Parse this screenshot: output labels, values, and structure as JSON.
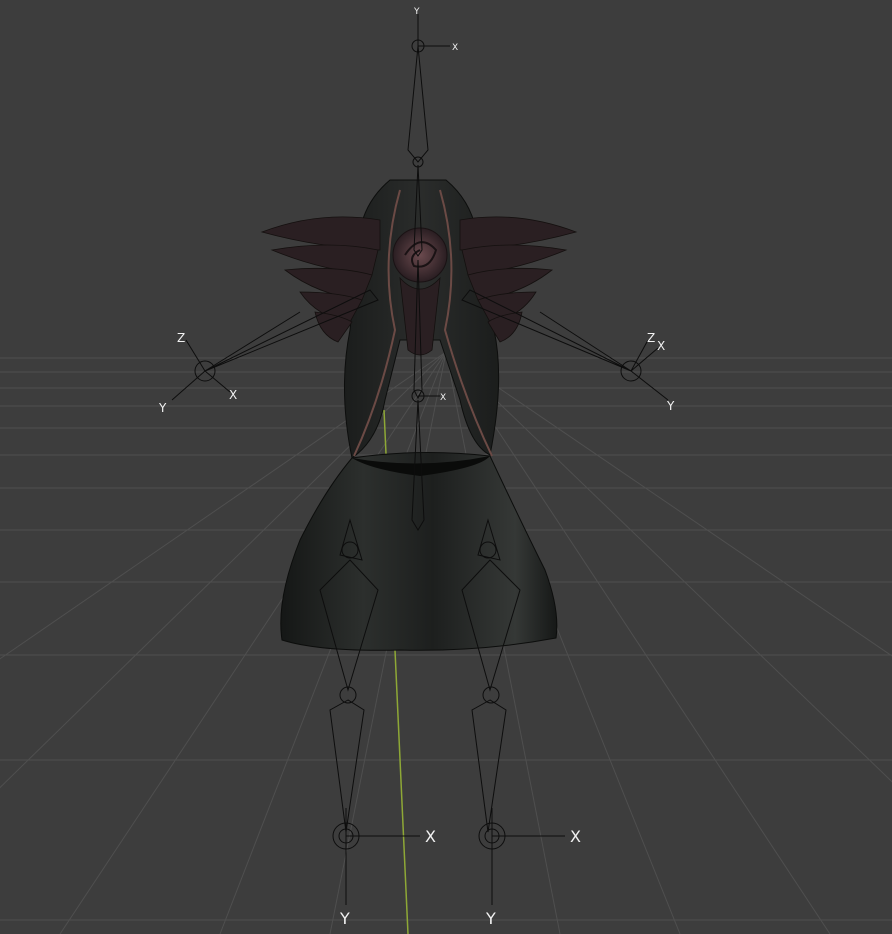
{
  "app": {
    "view": "3D viewport",
    "object": "rigged dress model"
  },
  "colors": {
    "background": "#3d3d3d",
    "grid": "#555555",
    "y_axis_line": "#8ea836",
    "bone": "#0d0d0d",
    "dress": "#1f2120",
    "dress_highlight": "#6b4a45",
    "feathers": "#2a1f22"
  },
  "axis_labels": {
    "head_y": "Y",
    "head_x": "X",
    "left_shoulder_z": "Z",
    "left_shoulder_y": "Y",
    "left_shoulder_x": "X",
    "right_shoulder_z": "Z",
    "right_shoulder_x": "X",
    "right_shoulder_y": "Y",
    "left_foot_x": "X",
    "left_foot_y": "Y",
    "right_foot_x": "X",
    "right_foot_y": "Y",
    "chest_x": "X"
  },
  "icons": {
    "bone_handle": "circle-target-icon"
  }
}
